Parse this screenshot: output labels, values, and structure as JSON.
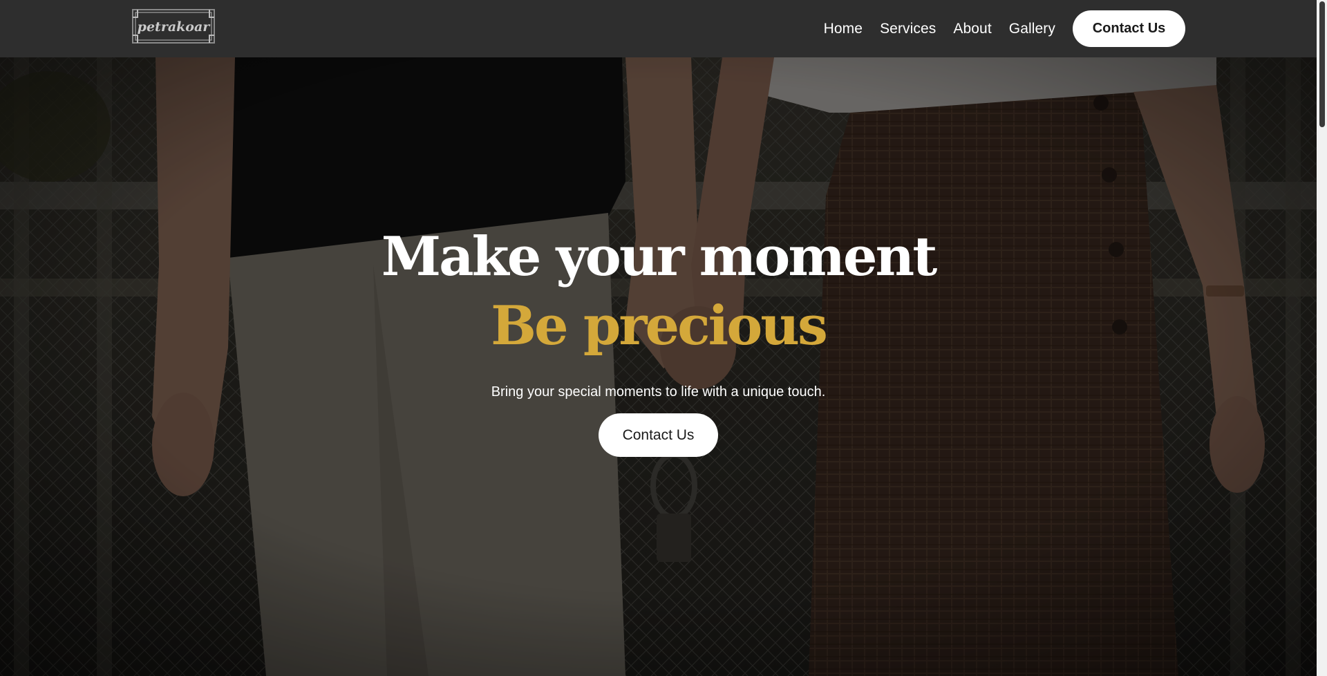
{
  "header": {
    "logo_text": "petrakoar",
    "nav": [
      {
        "label": "Home"
      },
      {
        "label": "Services"
      },
      {
        "label": "About"
      },
      {
        "label": "Gallery"
      }
    ],
    "cta_label": "Contact Us"
  },
  "hero": {
    "title_line_1": "Make your moment",
    "title_line_2": "Be precious",
    "subtitle": "Bring your special moments to life with a unique touch.",
    "cta_label": "Contact Us",
    "background_image": "couple holding hands in front of a gate",
    "accent_color": "#d4a83a"
  },
  "colors": {
    "header_bg": "#2e2e2e",
    "button_bg": "#ffffff",
    "button_text": "#1a1a1a",
    "accent": "#d4a83a"
  },
  "scrollbar": {
    "thumb_color": "#3a3a3a"
  }
}
